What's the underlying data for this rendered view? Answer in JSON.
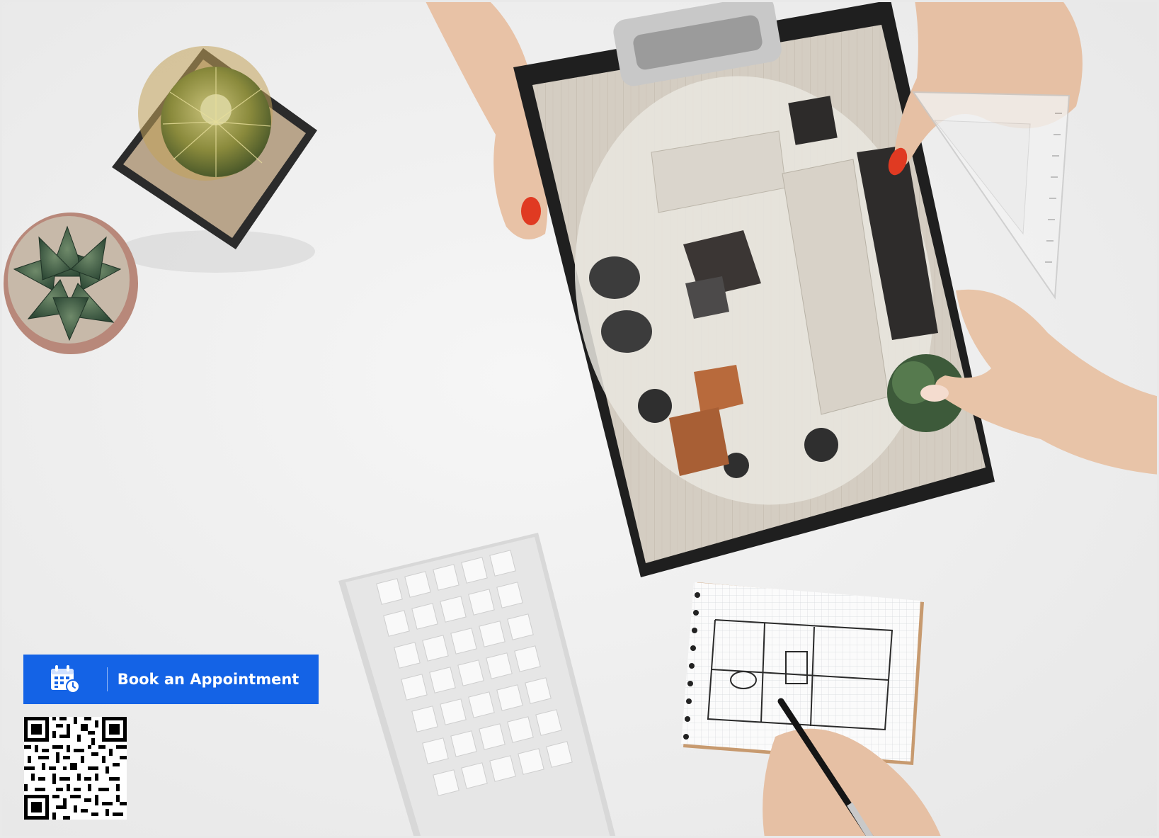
{
  "booking": {
    "label": "Book an Appointment",
    "icon": "calendar-clock-icon",
    "color": "#1463e6"
  },
  "qr": {
    "icon": "qr-code"
  },
  "hero": {
    "description_icons": [
      "cactus-pot",
      "succulent-pot",
      "clipboard-floor-plan",
      "keyboard",
      "sketch-notebook",
      "pen",
      "ruler"
    ]
  }
}
